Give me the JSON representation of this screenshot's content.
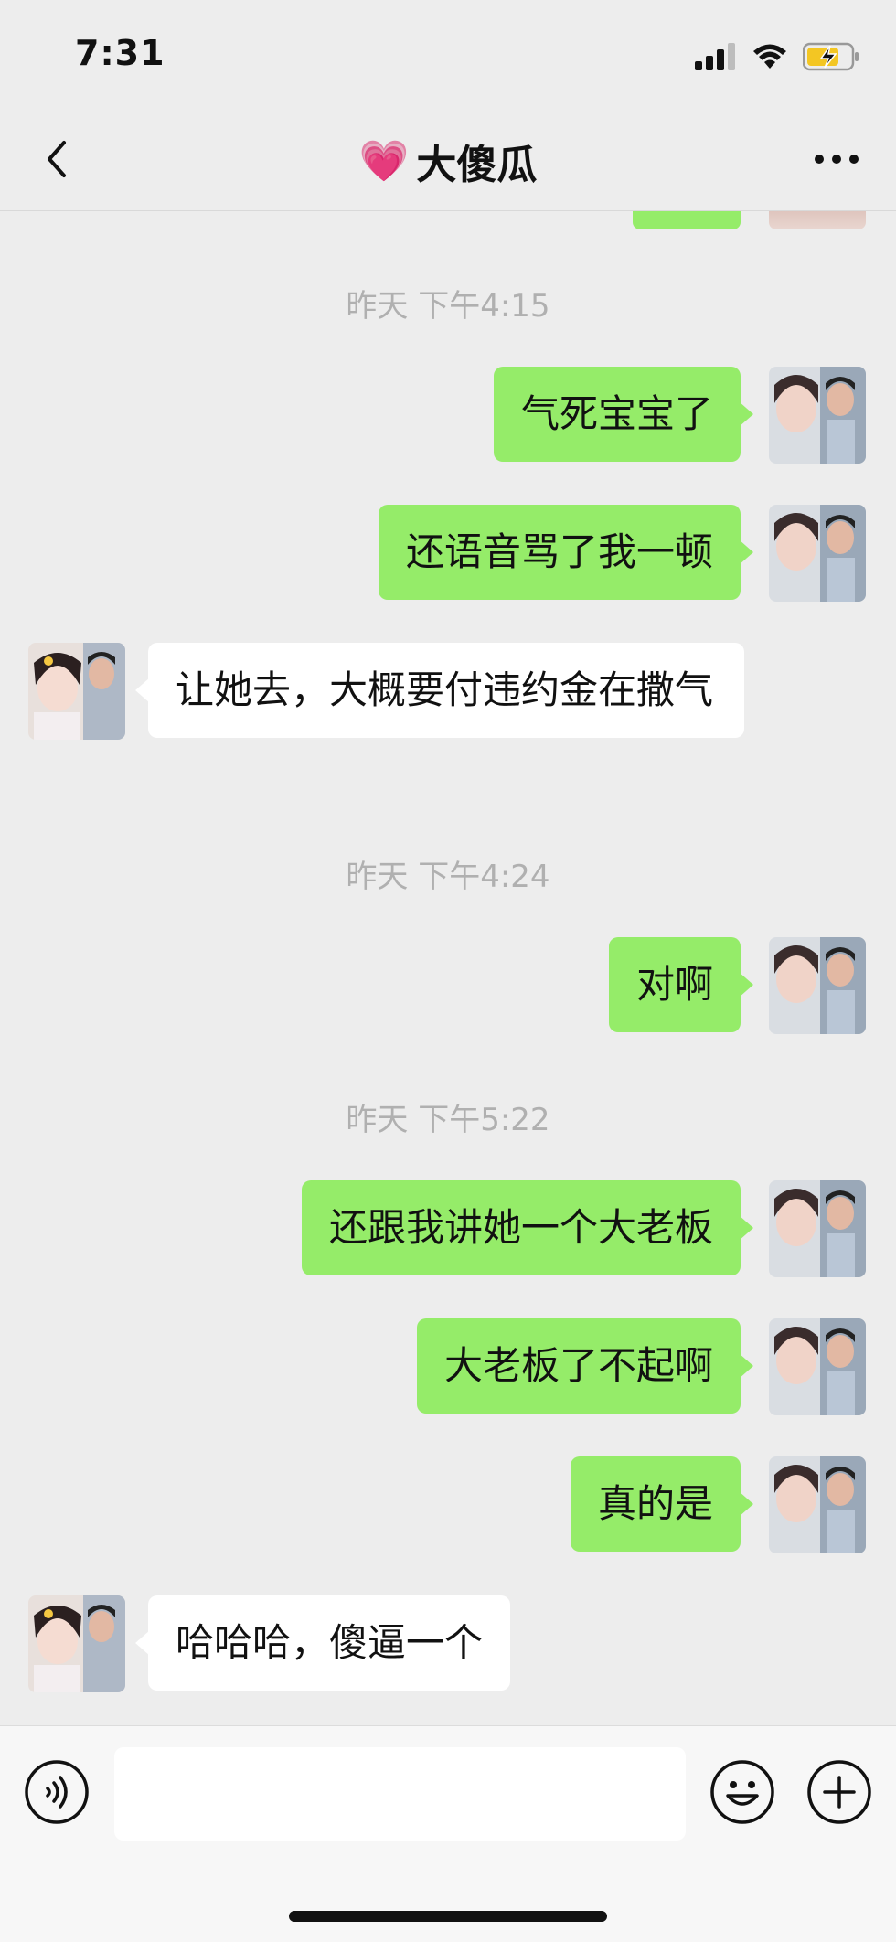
{
  "status_bar": {
    "time": "7:31",
    "icons": [
      "signal-icon",
      "wifi-icon",
      "battery-charging-icon"
    ]
  },
  "nav": {
    "title_emoji": "💗",
    "title": "大傻瓜",
    "back_icon": "chevron-left-icon",
    "more_icon": "more-dots-icon"
  },
  "messages": [
    {
      "type": "time",
      "text": "昨天 下午4:15"
    },
    {
      "type": "me",
      "text": "气死宝宝了"
    },
    {
      "type": "me",
      "text": "还语音骂了我一顿"
    },
    {
      "type": "them",
      "text": "让她去，大概要付违约金在撒气"
    },
    {
      "type": "time",
      "text": "昨天 下午4:24"
    },
    {
      "type": "me",
      "text": "对啊"
    },
    {
      "type": "time",
      "text": "昨天 下午5:22"
    },
    {
      "type": "me",
      "text": "还跟我讲她一个大老板"
    },
    {
      "type": "me",
      "text": "大老板了不起啊"
    },
    {
      "type": "me",
      "text": "真的是"
    },
    {
      "type": "them",
      "text": "哈哈哈，傻逼一个"
    }
  ],
  "input": {
    "value": "",
    "placeholder": ""
  },
  "colors": {
    "my_bubble": "#95ec69",
    "their_bubble": "#ffffff",
    "background": "#ededed"
  }
}
